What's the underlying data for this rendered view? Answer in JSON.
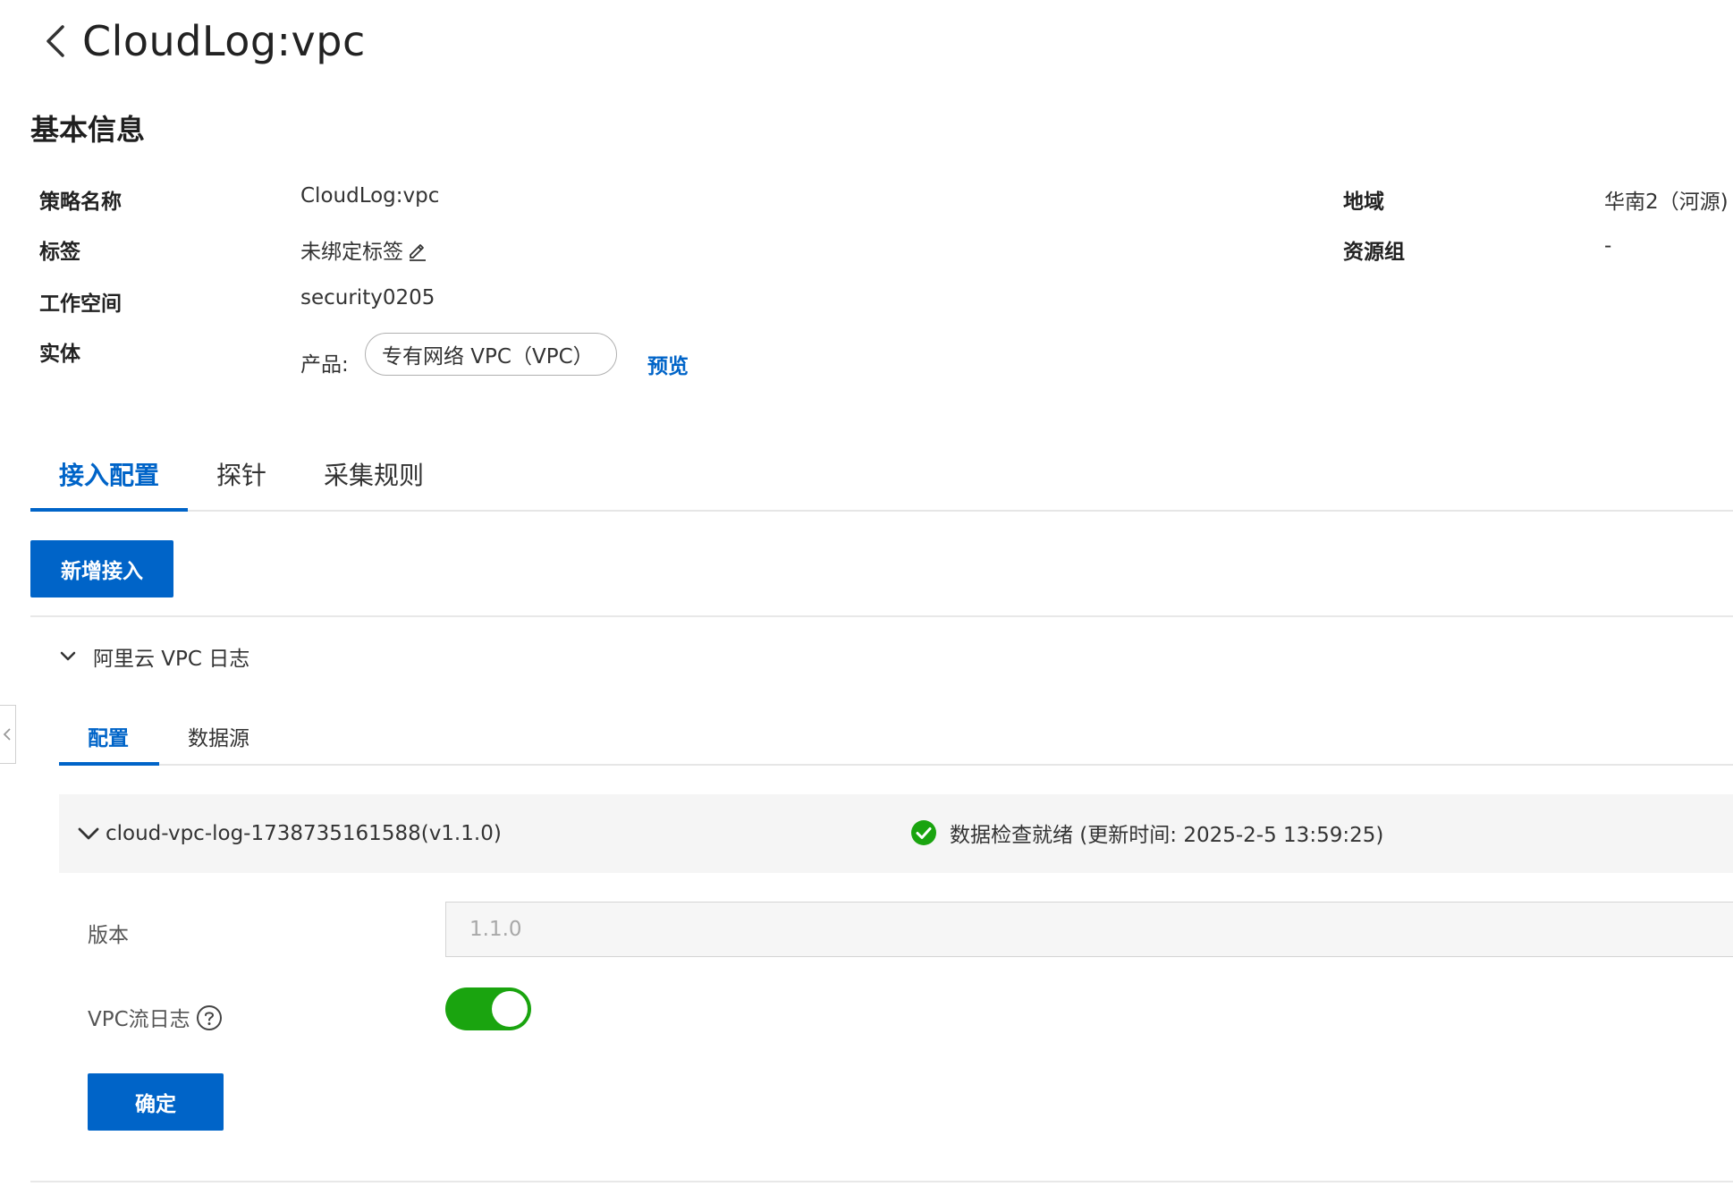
{
  "header": {
    "title": "CloudLog:vpc"
  },
  "basic_info": {
    "title": "基本信息",
    "rows": [
      {
        "label": "策略名称",
        "value": "CloudLog:vpc"
      },
      {
        "label": "标签",
        "value": "未绑定标签"
      },
      {
        "label": "工作空间",
        "value": "security0205"
      },
      {
        "label": "实体",
        "product_prefix": "产品:",
        "product_pill": "专有网络 VPC（VPC）",
        "preview_link": "预览"
      }
    ],
    "right_rows": [
      {
        "label": "地域",
        "value": "华南2（河源)"
      },
      {
        "label": "资源组",
        "value": "-"
      }
    ]
  },
  "main_tabs": [
    {
      "label": "接入配置",
      "active": true
    },
    {
      "label": "探针",
      "active": false
    },
    {
      "label": "采集规则",
      "active": false
    }
  ],
  "add_button": "新增接入",
  "collapse": {
    "title": "阿里云 VPC 日志"
  },
  "sub_tabs": [
    {
      "label": "配置",
      "active": true
    },
    {
      "label": "数据源",
      "active": false
    }
  ],
  "config_panel": {
    "title": "cloud-vpc-log-1738735161588(v1.1.0)",
    "status": "数据检查就绪 (更新时间: 2025-2-5 13:59:25)",
    "status_color": "#1aa40f"
  },
  "form": {
    "version_label": "版本",
    "version_value": "1.1.0",
    "flowlog_label": "VPC流日志",
    "flowlog_enabled": true,
    "confirm_button": "确定"
  },
  "colors": {
    "accent": "#0064c8",
    "success": "#1aa40f"
  }
}
